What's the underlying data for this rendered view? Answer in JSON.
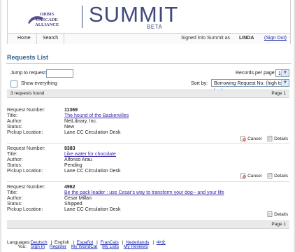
{
  "header": {
    "logo_line1": "ORBIS",
    "logo_line2": "CASCADE",
    "logo_line3": "ALLIANCE",
    "brand": "SUMMIT",
    "beta": "BETA"
  },
  "nav": {
    "home": "Home",
    "search": "Search",
    "signed_in": "Signed into Summit as",
    "user": "LINDA",
    "sign_out": "(Sign Out)"
  },
  "page_title": "Requests List",
  "controls": {
    "jump_label": "Jump to request:",
    "jump_value": "",
    "show_everything": "Show everything",
    "records_label": "Records per page:",
    "records_value": "10",
    "sort_label": "Sort by:",
    "sort_value": "Borrowing Request No. (high to low)"
  },
  "summary": {
    "found": "3 requests found",
    "page": "Page 1"
  },
  "field_labels": {
    "number": "Request Number:",
    "title": "Title:",
    "author": "Author:",
    "status": "Status:",
    "pickup": "Pickup Location:"
  },
  "actions": {
    "cancel": "Cancel",
    "details": "Details"
  },
  "requests": [
    {
      "number": "11369",
      "title": "The hound of the Baskervilles",
      "author": "NetLibrary, Inc.",
      "status": "New",
      "pickup": "Lane CC Circulation Desk"
    },
    {
      "number": "9383",
      "title": "Like water for chocolate",
      "author": "Alfonso Arau",
      "status": "Pending",
      "pickup": "Lane CC Circulation Desk"
    },
    {
      "number": "4962",
      "title": "Be the pack leader : use Cesar's way to transform your dog-- and your life",
      "author": "Cesar Millan",
      "status": "Shipped",
      "pickup": "Lane CC Circulation Desk"
    }
  ],
  "bottom_page": "Page 1",
  "footer": {
    "languages_label": "Languages:",
    "languages": [
      "Deutsch",
      "English",
      "Español",
      "FranCais",
      "Nederlands",
      "中文"
    ],
    "you_label": "You:",
    "you_links": [
      "Sign In",
      "Register",
      "My WorldCat",
      "My Lists",
      "My Reviews"
    ]
  }
}
